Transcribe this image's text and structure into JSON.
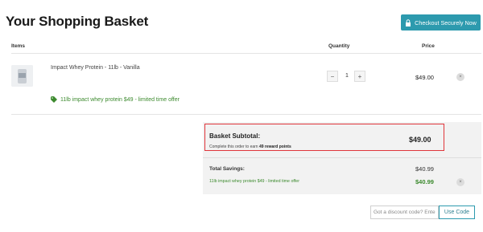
{
  "page": {
    "title": "Your Shopping Basket"
  },
  "checkout": {
    "label": "Checkout Securely Now",
    "icon": "lock-icon",
    "color": "#2d9aae"
  },
  "table": {
    "headers": {
      "items": "Items",
      "quantity": "Quantity",
      "price": "Price"
    }
  },
  "items": [
    {
      "name": "Impact Whey Protein - 11lb - Vanilla",
      "quantity": "1",
      "price": "$49.00",
      "offer": "11lb impact whey protein $49 - limited time offer"
    }
  ],
  "quantity_controls": {
    "minus": "−",
    "plus": "+"
  },
  "remove_symbol": "×",
  "summary": {
    "subtotal_label": "Basket Subtotal:",
    "subtotal_value": "$49.00",
    "points_note_prefix": "Complete this order to earn ",
    "points_note_bold": "49 reward points",
    "savings_label": "Total Savings:",
    "savings_total": "$40.99",
    "savings_items": [
      {
        "label": "11lb impact whey protein $49 - limited time offer",
        "value": "$40.99"
      }
    ]
  },
  "discount": {
    "placeholder": "Got a discount code? Enter it here",
    "button_label": "Use Code"
  },
  "colors": {
    "offer_green": "#3c8a2e",
    "highlight_red": "#e0353b"
  }
}
